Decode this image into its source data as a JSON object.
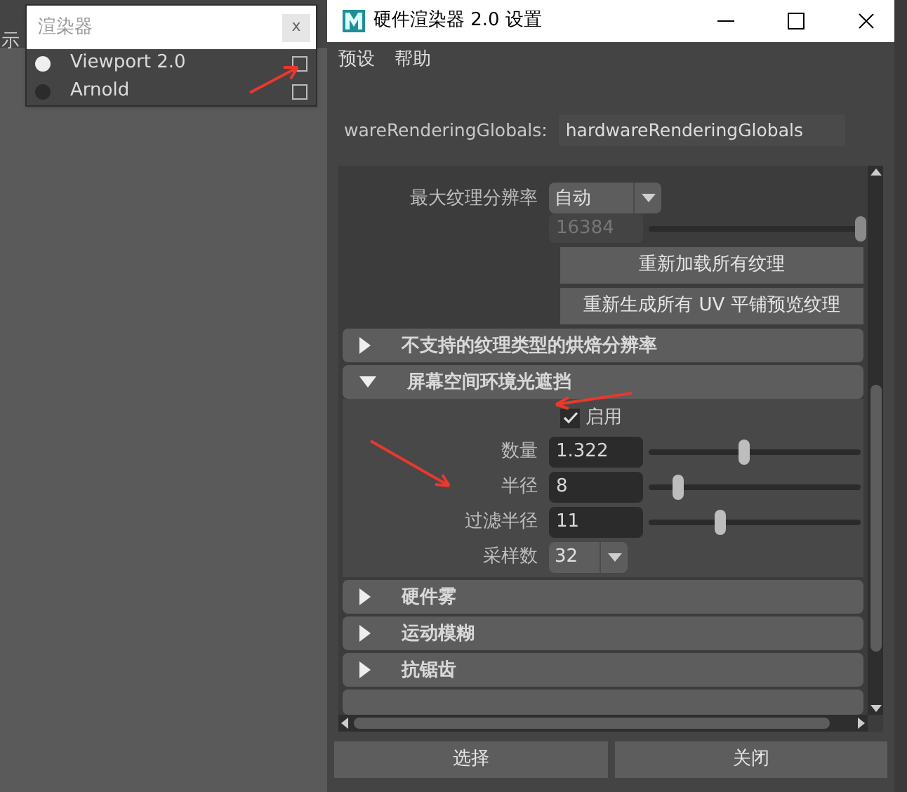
{
  "background": {
    "edge_text": "示"
  },
  "renderer_popup": {
    "title": "渲染器",
    "close": "x",
    "items": [
      {
        "name": "Viewport 2.0",
        "selected": true,
        "checked": false
      },
      {
        "name": "Arnold",
        "selected": false,
        "checked": false
      }
    ]
  },
  "window": {
    "title": "硬件渲染器 2.0 设置",
    "menu": [
      "预设",
      "帮助"
    ],
    "node_label": "wareRenderingGlobals:",
    "node_value": "hardwareRenderingGlobals",
    "texture": {
      "label": "最大纹理分辨率",
      "dropdown": "自动",
      "slider_value": "16384",
      "slider_disabled": true,
      "level": 1,
      "buttons": [
        "重新加载所有纹理",
        "重新生成所有 UV 平铺预览纹理"
      ]
    },
    "sections": [
      {
        "title": "不支持的纹理类型的烘焙分辨率",
        "expanded": false
      },
      {
        "title": "屏幕空间环境光遮挡",
        "expanded": true,
        "rows": [
          {
            "kind": "checkbox",
            "label": "启用",
            "checked": true
          },
          {
            "kind": "slider",
            "label": "数量",
            "value": "1.322",
            "level": 0.45
          },
          {
            "kind": "slider",
            "label": "半径",
            "value": "8",
            "level": 0.14
          },
          {
            "kind": "slider",
            "label": "过滤半径",
            "value": "11",
            "level": 0.34
          },
          {
            "kind": "dropdown",
            "label": "采样数",
            "value": "32"
          }
        ]
      },
      {
        "title": "硬件雾",
        "expanded": false
      },
      {
        "title": "运动模糊",
        "expanded": false
      },
      {
        "title": "抗锯齿",
        "expanded": false
      }
    ],
    "footer_buttons": [
      "选择",
      "关闭"
    ]
  }
}
